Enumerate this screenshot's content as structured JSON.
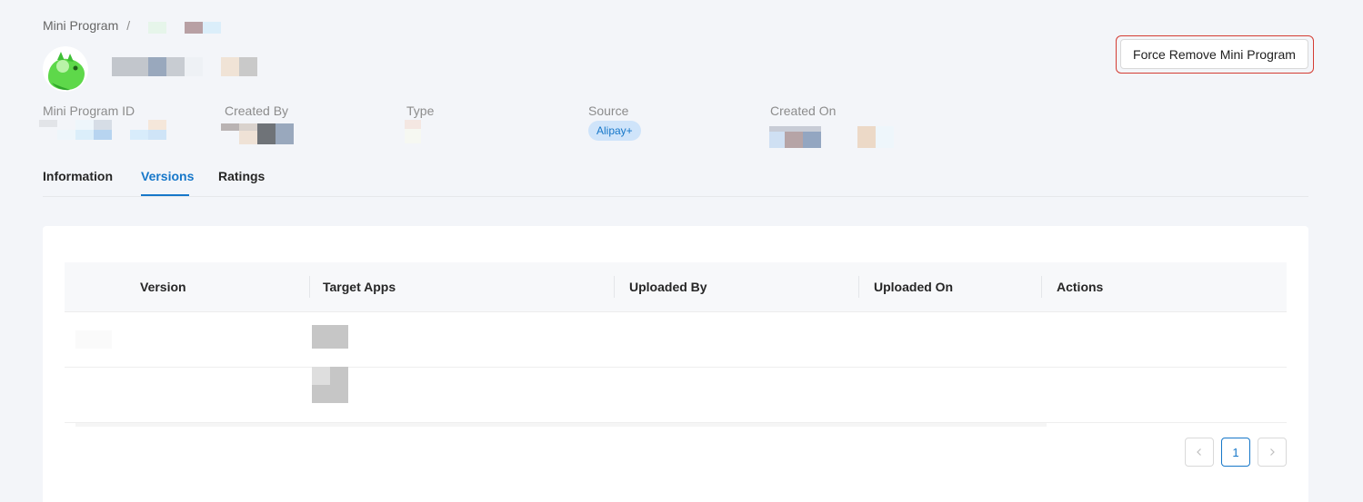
{
  "breadcrumb": {
    "root": "Mini Program",
    "separator": "/"
  },
  "actions": {
    "force_remove_label": "Force Remove Mini Program"
  },
  "meta": {
    "id_label": "Mini Program ID",
    "created_by_label": "Created By",
    "type_label": "Type",
    "source_label": "Source",
    "source_value": "Alipay+",
    "created_on_label": "Created On"
  },
  "tabs": [
    {
      "label": "Information"
    },
    {
      "label": "Versions",
      "active": true
    },
    {
      "label": "Ratings"
    }
  ],
  "table": {
    "columns": [
      "Version",
      "Target Apps",
      "Uploaded By",
      "Uploaded On",
      "Actions"
    ]
  },
  "pagination": {
    "prev_icon": "chevron-left-icon",
    "current_page": "1",
    "next_icon": "chevron-right-icon"
  },
  "colors": {
    "accent": "#1677c9",
    "danger_outline": "#d43c33",
    "tag_bg": "#cfe4fa"
  }
}
